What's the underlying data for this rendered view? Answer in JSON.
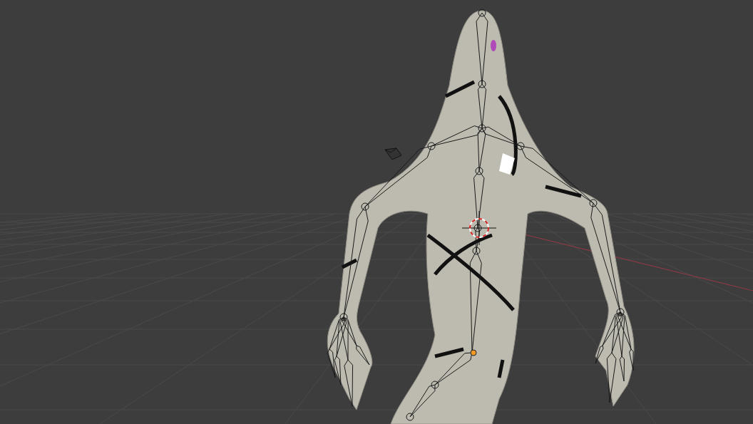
{
  "viewport": {
    "grid": true,
    "objects": [
      {
        "kind": "mesh"
      },
      {
        "kind": "armature"
      },
      {
        "kind": "camera"
      },
      {
        "kind": "cursor"
      },
      {
        "kind": "origin"
      }
    ]
  }
}
